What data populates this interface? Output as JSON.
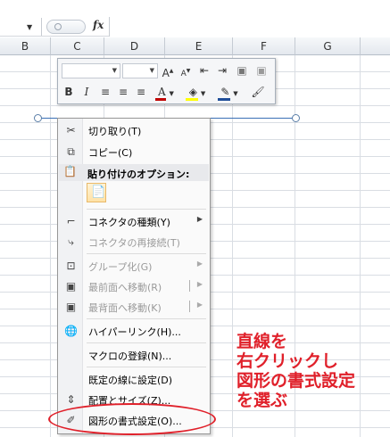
{
  "formula_bar": {
    "fx_label": "fx",
    "value": ""
  },
  "columns": [
    "B",
    "C",
    "D",
    "E",
    "F",
    "G"
  ],
  "mini_toolbar": {
    "font_name": "",
    "font_size": "",
    "grow_font": "A",
    "shrink_font": "A",
    "bold": "B",
    "italic": "I",
    "font_color": "A",
    "colors": {
      "font_underline": "#c00000",
      "fill_underline": "#ffff00",
      "outline_underline": "#1f4e99"
    }
  },
  "context_menu": {
    "items": [
      {
        "label": "切り取り(T)",
        "icon": "scissors-icon",
        "enabled": true
      },
      {
        "label": "コピー(C)",
        "icon": "copy-icon",
        "enabled": true
      },
      {
        "label": "貼り付けのオプション:",
        "icon": "paste-icon",
        "enabled": true,
        "header": true
      },
      {
        "label": "コネクタの種類(Y)",
        "icon": "connector-type-icon",
        "enabled": true,
        "submenu": true
      },
      {
        "label": "コネクタの再接続(T)",
        "icon": "reroute-connector-icon",
        "enabled": false
      },
      {
        "label": "グループ化(G)",
        "icon": "group-icon",
        "enabled": false,
        "submenu": true
      },
      {
        "label": "最前面へ移動(R)",
        "icon": "bring-front-icon",
        "enabled": false,
        "submenu": true
      },
      {
        "label": "最背面へ移動(K)",
        "icon": "send-back-icon",
        "enabled": false,
        "submenu": true
      },
      {
        "label": "ハイパーリンク(H)...",
        "icon": "hyperlink-icon",
        "enabled": true
      },
      {
        "label": "マクロの登録(N)...",
        "icon": "",
        "enabled": true
      },
      {
        "label": "既定の線に設定(D)",
        "icon": "",
        "enabled": true
      },
      {
        "label": "配置とサイズ(Z)...",
        "icon": "size-position-icon",
        "enabled": true
      },
      {
        "label": "図形の書式設定(O)...",
        "icon": "format-shape-icon",
        "enabled": true
      }
    ]
  },
  "annotation": {
    "lines": [
      "直線を",
      "右クリックし",
      "図形の書式設定",
      "を選ぶ"
    ],
    "color": "#e0202a"
  }
}
